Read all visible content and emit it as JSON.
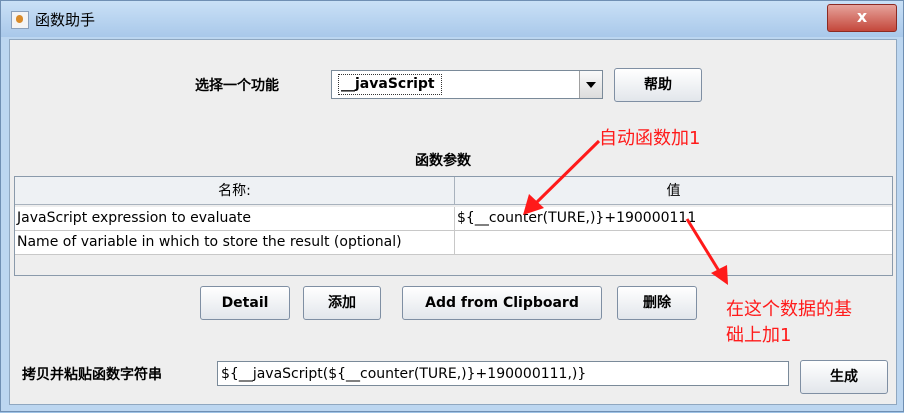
{
  "window": {
    "title": "函数助手",
    "close_label": "x"
  },
  "function_select": {
    "label": "选择一个功能",
    "selected": "__javaScript",
    "help_label": "帮助"
  },
  "params": {
    "section_title": "函数参数",
    "columns": [
      "名称:",
      "值"
    ],
    "rows": [
      {
        "name": "JavaScript expression to evaluate",
        "value": "${__counter(TURE,)}+190000111"
      },
      {
        "name": "Name of variable in which to store the result (optional)",
        "value": ""
      }
    ]
  },
  "actions": {
    "detail": "Detail",
    "add": "添加",
    "add_clipboard": "Add from Clipboard",
    "delete": "删除"
  },
  "output": {
    "label": "拷贝并粘贴函数字符串",
    "value": "${__javaScript(${__counter(TURE,)}+190000111,)}",
    "generate": "生成"
  },
  "annotations": {
    "top": "自动函数加1",
    "bottom_line1": "在这个数据的基",
    "bottom_line2": "础上加1"
  },
  "colors": {
    "annotation": "#ff1a1a"
  }
}
